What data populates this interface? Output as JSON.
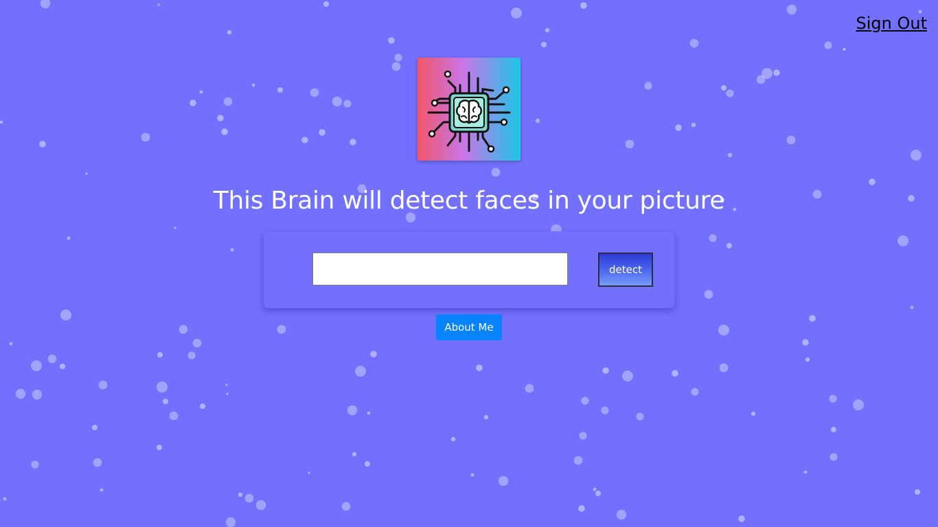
{
  "nav": {
    "sign_out_label": "Sign Out"
  },
  "logo": {
    "icon": "brain-chip-icon"
  },
  "headline": {
    "text": "This Brain will detect faces in your picture"
  },
  "form": {
    "input_value": "",
    "input_placeholder": "",
    "detect_label": "detect"
  },
  "about": {
    "label": "About Me"
  },
  "colors": {
    "background": "#7270fd",
    "particle": "#ffffff",
    "about_button": "#0784fd",
    "logo_gradient": [
      "#f2566a",
      "#c876e8",
      "#1cc6e6"
    ]
  },
  "background_effect": "particles"
}
